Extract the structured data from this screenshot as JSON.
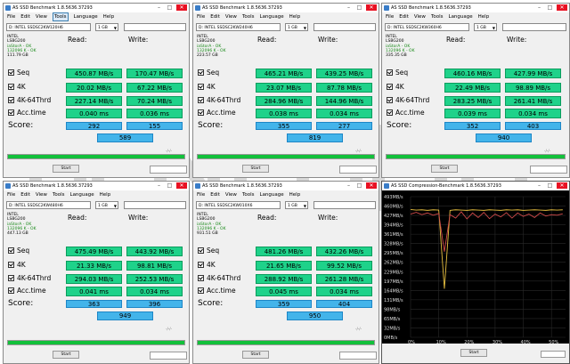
{
  "app_title": "AS SSD Benchmark 1.8.5636.37293",
  "menu": [
    "File",
    "Edit",
    "View",
    "Tools",
    "Language",
    "Help"
  ],
  "size_option": "1 GB",
  "col_read": "Read:",
  "col_write": "Write:",
  "rows": [
    "Seq",
    "4K",
    "4K-64Thrd",
    "Acc.time"
  ],
  "score_label": "Score:",
  "start_label": "Start",
  "slash_text": "-/-/-",
  "windows": [
    {
      "drive": "D: INTEL SSDSC2KW120H6",
      "info": [
        "INTEL",
        "LSBG200",
        "iaStorA - OK",
        "132096 K - OK",
        "111.79 GB"
      ],
      "seq": [
        "450.87 MB/s",
        "170.47 MB/s"
      ],
      "k4": [
        "20.02 MB/s",
        "67.22 MB/s"
      ],
      "k64": [
        "227.14 MB/s",
        "70.24 MB/s"
      ],
      "acc": [
        "0.040 ms",
        "0.036 ms"
      ],
      "score": [
        "292",
        "155"
      ],
      "total": "589"
    },
    {
      "drive": "D: INTEL SSDSC2KW240H6",
      "info": [
        "INTEL",
        "LSBG200",
        "iaStorA - OK",
        "132096 K - OK",
        "223.57 GB"
      ],
      "seq": [
        "465.21 MB/s",
        "439.25 MB/s"
      ],
      "k4": [
        "23.07 MB/s",
        "87.78 MB/s"
      ],
      "k64": [
        "284.96 MB/s",
        "144.96 MB/s"
      ],
      "acc": [
        "0.038 ms",
        "0.034 ms"
      ],
      "score": [
        "355",
        "277"
      ],
      "total": "819"
    },
    {
      "drive": "D: INTEL SSDSC2KW360H6",
      "info": [
        "INTEL",
        "LSBG200",
        "iaStorA - OK",
        "132096 K - OK",
        "335.35 GB"
      ],
      "seq": [
        "460.16 MB/s",
        "427.99 MB/s"
      ],
      "k4": [
        "22.49 MB/s",
        "98.89 MB/s"
      ],
      "k64": [
        "283.25 MB/s",
        "261.41 MB/s"
      ],
      "acc": [
        "0.039 ms",
        "0.034 ms"
      ],
      "score": [
        "352",
        "403"
      ],
      "total": "940"
    },
    {
      "drive": "D: INTEL SSDSC2KW480H6",
      "info": [
        "INTEL",
        "LSBG200",
        "iaStorA - OK",
        "132096 K - OK",
        "447.13 GB"
      ],
      "seq": [
        "475.49 MB/s",
        "443.92 MB/s"
      ],
      "k4": [
        "21.33 MB/s",
        "98.81 MB/s"
      ],
      "k64": [
        "294.03 MB/s",
        "252.53 MB/s"
      ],
      "acc": [
        "0.041 ms",
        "0.034 ms"
      ],
      "score": [
        "363",
        "396"
      ],
      "total": "949"
    },
    {
      "drive": "D: INTEL SSDSC2KW010X6",
      "info": [
        "INTEL",
        "LSBG200",
        "iaStorA - OK",
        "132096 K - OK",
        "931.51 GB"
      ],
      "seq": [
        "481.26 MB/s",
        "432.26 MB/s"
      ],
      "k4": [
        "21.65 MB/s",
        "99.52 MB/s"
      ],
      "k64": [
        "288.92 MB/s",
        "261.28 MB/s"
      ],
      "acc": [
        "0.045 ms",
        "0.034 ms"
      ],
      "score": [
        "359",
        "404"
      ],
      "total": "950"
    }
  ],
  "compression": {
    "title": "AS SSD Compression-Benchmark 1.8.5636.37293",
    "start_label": "Start",
    "chart_data": {
      "type": "line",
      "y_ticks": [
        "493MB/s",
        "460MB/s",
        "427MB/s",
        "394MB/s",
        "361MB/s",
        "328MB/s",
        "295MB/s",
        "262MB/s",
        "229MB/s",
        "197MB/s",
        "164MB/s",
        "131MB/s",
        "98MB/s",
        "65MB/s",
        "32MB/s",
        "0MB/s"
      ],
      "x_ticks": [
        "0%",
        "10%",
        "20%",
        "30%",
        "40%",
        "50%"
      ],
      "ylim": [
        0,
        493
      ],
      "xlim": [
        0,
        55
      ],
      "series": [
        {
          "color": "#e8c040",
          "x": [
            0,
            2,
            4,
            6,
            8,
            10,
            12,
            14,
            16,
            18,
            20,
            22,
            24,
            26,
            28,
            30,
            32,
            34,
            36,
            38,
            40,
            42,
            44,
            46,
            48,
            50,
            52,
            54
          ],
          "values": [
            448,
            446,
            447,
            445,
            447,
            446,
            170,
            445,
            447,
            446,
            445,
            447,
            446,
            445,
            447,
            446,
            445,
            447,
            446,
            447,
            445,
            446,
            447,
            446,
            445,
            447,
            446,
            447
          ]
        },
        {
          "color": "#d04a4a",
          "x": [
            0,
            2,
            4,
            6,
            8,
            10,
            12,
            14,
            16,
            18,
            20,
            22,
            24,
            26,
            28,
            30,
            32,
            34,
            36,
            38,
            40,
            42,
            44,
            46,
            48,
            50,
            52,
            54
          ],
          "values": [
            432,
            438,
            430,
            436,
            428,
            434,
            300,
            430,
            418,
            440,
            415,
            436,
            420,
            438,
            416,
            432,
            422,
            437,
            418,
            436,
            424,
            432,
            420,
            436,
            425,
            430,
            428,
            433
          ]
        }
      ]
    }
  }
}
